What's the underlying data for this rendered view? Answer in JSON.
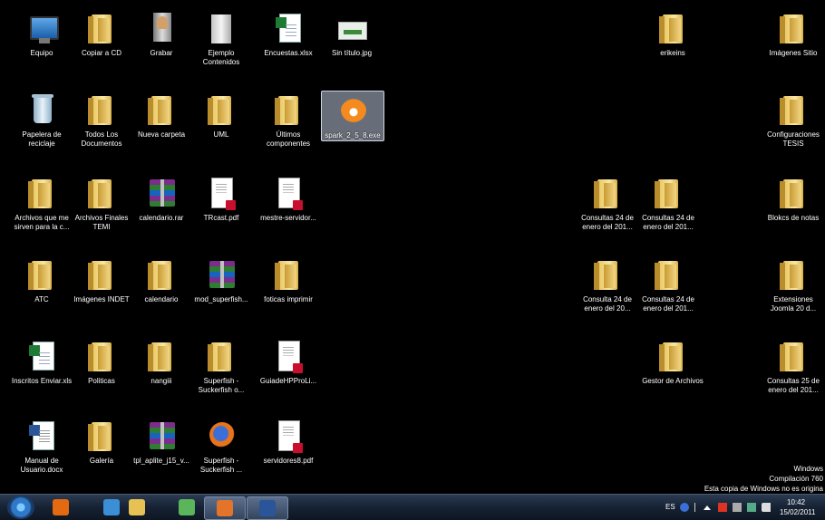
{
  "desktop": {
    "icons": [
      {
        "label": "Equipo",
        "type": "computer"
      },
      {
        "label": "Copiar a CD",
        "type": "folder"
      },
      {
        "label": "Grabar",
        "type": "burn"
      },
      {
        "label": "Ejemplo Contenidos",
        "type": "disc-folder"
      },
      {
        "label": "Encuestas.xlsx",
        "type": "xls"
      },
      {
        "label": "Sin título.jpg",
        "type": "jpg"
      },
      {
        "label": "erikeins",
        "type": "folder"
      },
      {
        "label": "Imágenes Sitio",
        "type": "folder"
      },
      {
        "label": "Papelera de reciclaje",
        "type": "bin"
      },
      {
        "label": "Todos Los Documentos",
        "type": "folder"
      },
      {
        "label": "Nueva carpeta",
        "type": "folder"
      },
      {
        "label": "UML",
        "type": "folder"
      },
      {
        "label": "Últimos componentes",
        "type": "folder"
      },
      {
        "label": "spark_2_5_8.exe",
        "type": "spark",
        "selected": true
      },
      {
        "label": "Configuraciones TESIS",
        "type": "folder"
      },
      {
        "label": "Archivos que me sirven para la c...",
        "type": "folder"
      },
      {
        "label": "Archivos Finales TEMI",
        "type": "folder"
      },
      {
        "label": "calendario.rar",
        "type": "rar"
      },
      {
        "label": "TRcast.pdf",
        "type": "pdf"
      },
      {
        "label": "mestre-servidor...",
        "type": "pdf"
      },
      {
        "label": "Consultas 24 de enero del 201...",
        "type": "folder"
      },
      {
        "label": "Consultas 24 de enero del 201...",
        "type": "folder"
      },
      {
        "label": "Blokcs de notas",
        "type": "folder"
      },
      {
        "label": "ATC",
        "type": "folder"
      },
      {
        "label": "Imágenes INDET",
        "type": "folder"
      },
      {
        "label": "calendario",
        "type": "folder"
      },
      {
        "label": "mod_superfish...",
        "type": "rar"
      },
      {
        "label": "foticas imprimir",
        "type": "folder"
      },
      {
        "label": "Consulta 24 de enero del 20...",
        "type": "folder"
      },
      {
        "label": "Consultas 24 de enero del 201...",
        "type": "folder"
      },
      {
        "label": "Extensiones Joomla 20 d...",
        "type": "folder"
      },
      {
        "label": "Inscritos Enviar.xls",
        "type": "xls"
      },
      {
        "label": "Politicas",
        "type": "folder"
      },
      {
        "label": "nangiii",
        "type": "folder"
      },
      {
        "label": "Superfish - Suckerfish o...",
        "type": "folder"
      },
      {
        "label": "GuiadeHPProLi...",
        "type": "pdf"
      },
      {
        "label": "Gestor de Archivos",
        "type": "folder"
      },
      {
        "label": "Consultas 25 de enero del 201...",
        "type": "folder"
      },
      {
        "label": "Manual de Usuario.docx",
        "type": "docx"
      },
      {
        "label": "Galería",
        "type": "folder"
      },
      {
        "label": "tpl_aplite_j15_v...",
        "type": "rar"
      },
      {
        "label": "Superfish - Suckerfish ...",
        "type": "ff"
      },
      {
        "label": "servidores8.pdf",
        "type": "pdf"
      }
    ]
  },
  "watermark": {
    "line1": "Windows",
    "line2": "Compilación 760",
    "line3": "Esta copia de Windows no es origina"
  },
  "taskbar": {
    "pinned": [
      {
        "name": "media-player-icon",
        "color": "#e46a12"
      },
      {
        "name": "internet-explorer-icon",
        "color": "#3b8fd6"
      },
      {
        "name": "windows-explorer-icon",
        "color": "#e7c153"
      },
      {
        "name": "people-icon",
        "color": "#5bb55b"
      },
      {
        "name": "app-icon",
        "color": "#e4742a",
        "active": true
      },
      {
        "name": "word-icon",
        "color": "#2a5599",
        "active": true
      }
    ],
    "language": "ES",
    "time": "10:42",
    "date": "15/02/2011"
  }
}
